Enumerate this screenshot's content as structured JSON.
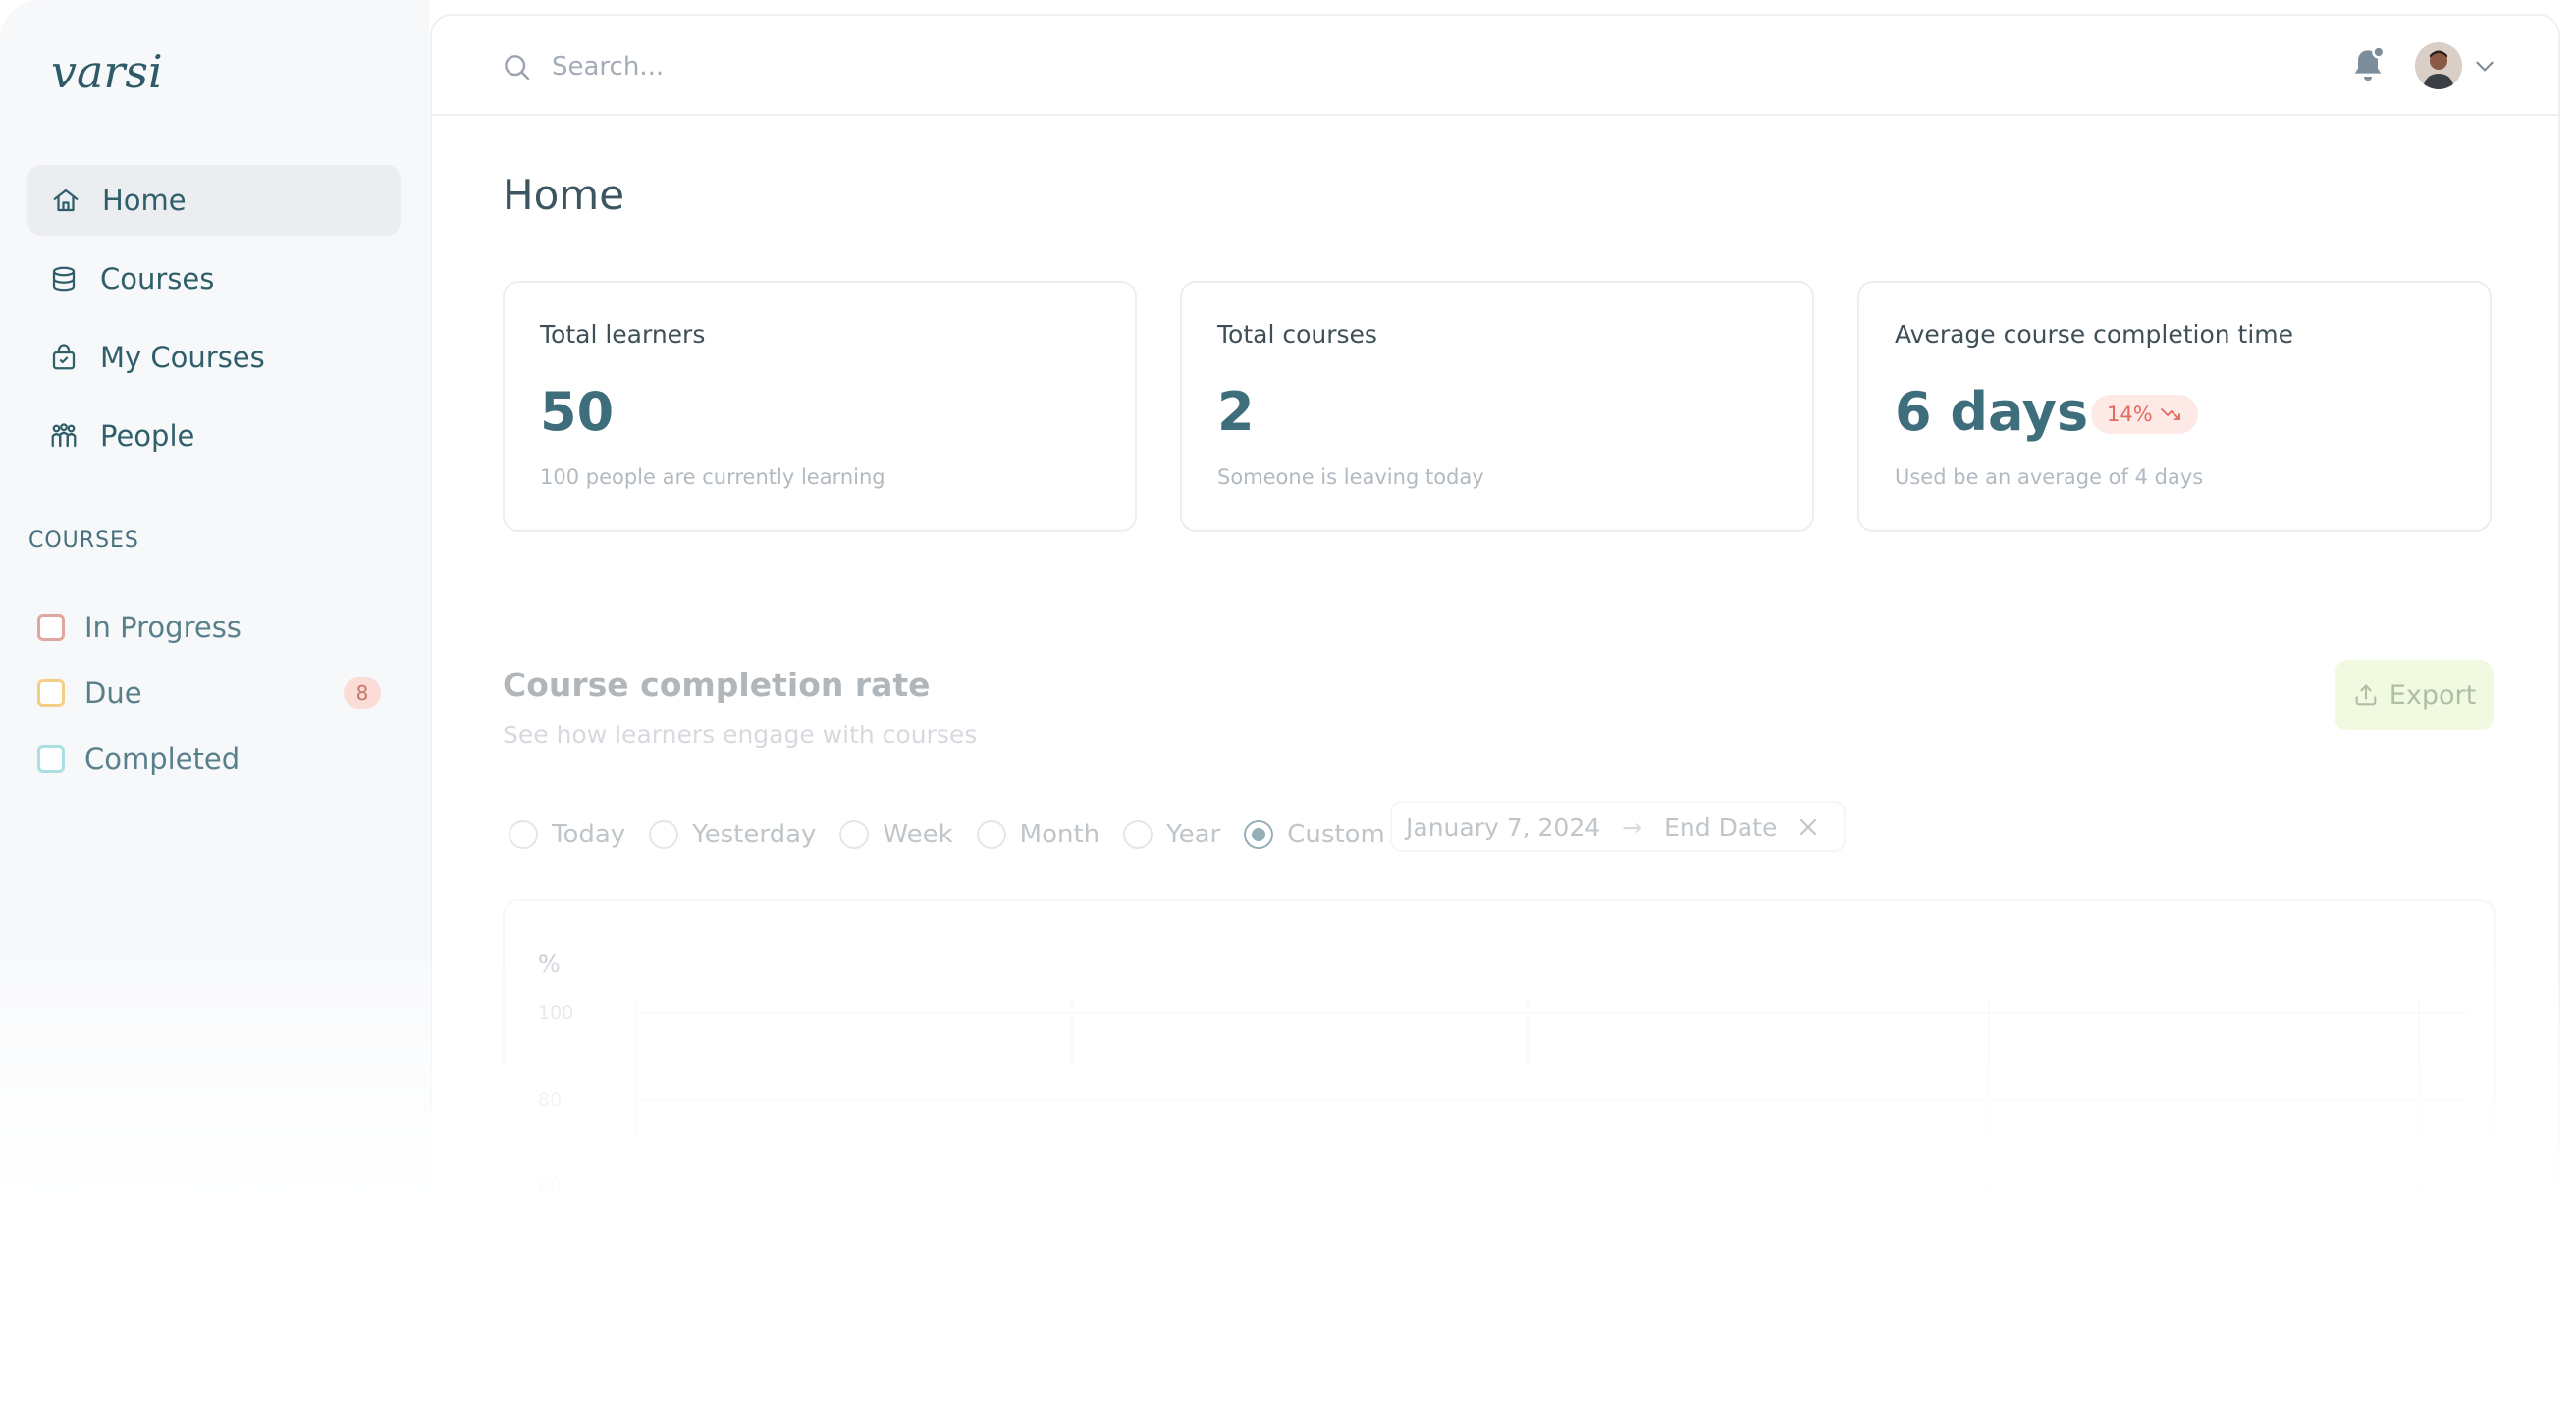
{
  "logo": {
    "text": "varsi"
  },
  "nav": {
    "items": [
      {
        "label": "Home",
        "icon": "home-icon",
        "active": true
      },
      {
        "label": "Courses",
        "icon": "stack-icon",
        "active": false
      },
      {
        "label": "My Courses",
        "icon": "bag-icon",
        "active": false
      },
      {
        "label": "People",
        "icon": "people-icon",
        "active": false
      }
    ]
  },
  "courses_section": {
    "label": "COURSES",
    "items": [
      {
        "label": "In Progress",
        "color": "#e0a7a0",
        "badge": ""
      },
      {
        "label": "Due",
        "color": "#f2cf85",
        "badge": "8"
      },
      {
        "label": "Completed",
        "color": "#a9dfe0",
        "badge": ""
      }
    ]
  },
  "search": {
    "placeholder": "Search..."
  },
  "page": {
    "title": "Home"
  },
  "cards": [
    {
      "label": "Total learners",
      "value": "50",
      "sub": "100 people are currently learning"
    },
    {
      "label": "Total courses",
      "value": "2",
      "sub": "Someone is leaving today"
    },
    {
      "label": "Average course completion time",
      "value": "6 days",
      "trend": "14%",
      "sub": "Used be an average of 4 days"
    }
  ],
  "completion": {
    "title": "Course completion rate",
    "subtitle": "See how learners engage with courses",
    "export_label": "Export",
    "ranges": [
      "Today",
      "Yesterday",
      "Week",
      "Month",
      "Year",
      "Custom"
    ],
    "selected_range": "Custom",
    "start_date": "January 7, 2024",
    "end_date_placeholder": "End Date"
  },
  "chart_data": {
    "type": "line",
    "ylabel": "%",
    "y_ticks": [
      "100",
      "80",
      "60"
    ],
    "ylim": [
      60,
      100
    ],
    "grid": true
  },
  "colors": {
    "accent": "#3e6d7b",
    "badge_red": "#e06a5c",
    "export_bg": "#e6f6c9"
  }
}
